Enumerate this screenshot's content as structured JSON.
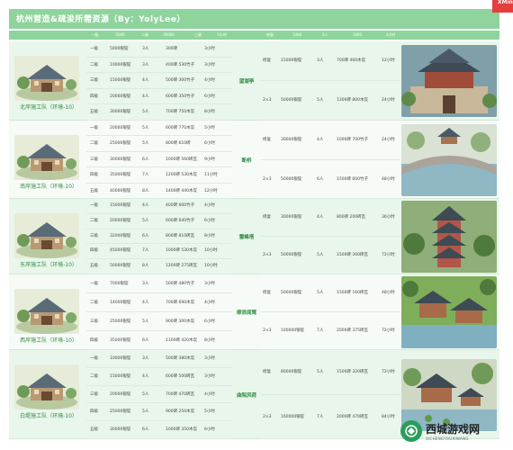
{
  "title": "杭州营造&疏浚所需资源（By：YolyLee）",
  "badge": "XMind",
  "header": [
    "",
    "一级",
    "5000",
    "二级",
    "30000",
    "三级",
    "5小时",
    "",
    "修复",
    "1000",
    "3人",
    "1000",
    "3小时",
    ""
  ],
  "sections": [
    {
      "team": "北岸施工队（环境-10）",
      "building": "望湖亭",
      "rows": [
        {
          "level": "一级",
          "cost": "5000银锭",
          "people": "3人",
          "material": "300砖",
          "time": "3小时"
        },
        {
          "level": "二级",
          "cost": "10000银锭",
          "people": "3人",
          "material": "400砖 530竹子",
          "time": "3小时"
        },
        {
          "level": "三级",
          "cost": "15000银锭",
          "people": "4人",
          "material": "500砖 300竹子",
          "time": "4小时"
        },
        {
          "level": "四级",
          "cost": "20000银锭",
          "people": "4人",
          "material": "600砖 350竹子",
          "time": "6小时"
        },
        {
          "level": "五级",
          "cost": "30000银锭",
          "people": "5人",
          "material": "700砖 750木炭",
          "time": "8小时"
        }
      ],
      "repair": [
        {
          "type": "修复",
          "cost": "15000银锭",
          "people": "3人",
          "material": "700砖 460木炭",
          "time": "12小时"
        },
        {
          "type": "2×3",
          "cost": "50000银锭",
          "people": "5人",
          "material": "1300砖 800木炭",
          "time": "24小时"
        }
      ]
    },
    {
      "team": "南岸施工队（环境-10）",
      "building": "断桥",
      "rows": [
        {
          "level": "一级",
          "cost": "20000银锭",
          "people": "5人",
          "material": "600砖 770木炭",
          "time": "5小时"
        },
        {
          "level": "二级",
          "cost": "25000银锭",
          "people": "5人",
          "material": "800砖 610砖",
          "time": "6小时"
        },
        {
          "level": "三级",
          "cost": "30000银锭",
          "people": "6人",
          "material": "1000砖 560砖瓦",
          "time": "9小时"
        },
        {
          "level": "四级",
          "cost": "35000银锭",
          "people": "7人",
          "material": "1200砖 530木炭",
          "time": "11小时"
        },
        {
          "level": "五级",
          "cost": "40000银锭",
          "people": "8人",
          "material": "1400砖 440木炭",
          "time": "12小时"
        }
      ],
      "repair": [
        {
          "type": "修复",
          "cost": "30000银锭",
          "people": "4人",
          "material": "1000砖 700竹子",
          "time": "24小时"
        },
        {
          "type": "2×3",
          "cost": "50000银锭",
          "people": "6人",
          "material": "1500砖 600竹子",
          "time": "48小时"
        }
      ]
    },
    {
      "team": "东岸施工队（环境-10）",
      "building": "雷峰塔",
      "rows": [
        {
          "level": "一级",
          "cost": "15000银锭",
          "people": "4人",
          "material": "400砖 600竹子",
          "time": "4小时"
        },
        {
          "level": "二级",
          "cost": "20000银锭",
          "people": "5人",
          "material": "600砖 640竹子",
          "time": "6小时"
        },
        {
          "level": "三级",
          "cost": "32000银锭",
          "people": "6人",
          "material": "800砖 810砖瓦",
          "time": "8小时"
        },
        {
          "level": "四级",
          "cost": "45000银锭",
          "people": "7人",
          "material": "1000砖 530木炭",
          "time": "10小时"
        },
        {
          "level": "五级",
          "cost": "50000银锭",
          "people": "8人",
          "material": "1200砖 275砖瓦",
          "time": "10小时"
        }
      ],
      "repair": [
        {
          "type": "修复",
          "cost": "30000银锭",
          "people": "4人",
          "material": "800砖 200砖瓦",
          "time": "36小时"
        },
        {
          "type": "2×3",
          "cost": "50000银锭",
          "people": "5人",
          "material": "1500砖 300砖瓦",
          "time": "72小时"
        }
      ]
    },
    {
      "team": "西岸施工队（环境-10）",
      "building": "柳浪闻莺",
      "rows": [
        {
          "level": "一级",
          "cost": "7000银锭",
          "people": "3人",
          "material": "500砖 480竹子",
          "time": "3小时"
        },
        {
          "level": "二级",
          "cost": "14000银锭",
          "people": "4人",
          "material": "700砖 690木炭",
          "time": "4小时"
        },
        {
          "level": "三级",
          "cost": "25000银锭",
          "people": "5人",
          "material": "900砖 300木炭",
          "time": "6小时"
        },
        {
          "level": "四级",
          "cost": "35000银锭",
          "people": "6人",
          "material": "1100砖 420木炭",
          "time": "8小时"
        }
      ],
      "repair": [
        {
          "type": "修复",
          "cost": "50000银锭",
          "people": "5人",
          "material": "1500砖 160砖瓦",
          "time": "48小时"
        },
        {
          "type": "2×3",
          "cost": "100000银锭",
          "people": "7人",
          "material": "2000砖 375砖瓦",
          "time": "72小时"
        }
      ]
    },
    {
      "team": "白堤施工队（环境-10）",
      "building": "曲院风荷",
      "rows": [
        {
          "level": "一级",
          "cost": "10000银锭",
          "people": "3人",
          "material": "500砖 380木炭",
          "time": "3小时"
        },
        {
          "level": "二级",
          "cost": "15000银锭",
          "people": "4人",
          "material": "600砖 500砖瓦",
          "time": "3小时"
        },
        {
          "level": "三级",
          "cost": "20000银锭",
          "people": "5人",
          "material": "700砖 470砖瓦",
          "time": "4小时"
        },
        {
          "level": "四级",
          "cost": "25000银锭",
          "people": "5人",
          "material": "900砖 250木炭",
          "time": "5小时"
        },
        {
          "level": "五级",
          "cost": "30000银锭",
          "people": "6人",
          "material": "1000砖 350木炭",
          "time": "6小时"
        }
      ],
      "repair": [
        {
          "type": "修复",
          "cost": "80000银锭",
          "people": "5人",
          "material": "1500砖 320砖瓦",
          "time": "72小时"
        },
        {
          "type": "2×3",
          "cost": "160000银锭",
          "people": "7人",
          "material": "2000砖 470砖瓦",
          "time": "84小时"
        }
      ]
    }
  ],
  "watermark": {
    "main": "西城游戏网",
    "sub": "XICHENGYOUXIWANG"
  },
  "colors": {
    "accent": "#8fd49c",
    "label_green": "#2f8a3f",
    "row_alt": "#e9f6ec",
    "badge": "#e53e3e"
  }
}
